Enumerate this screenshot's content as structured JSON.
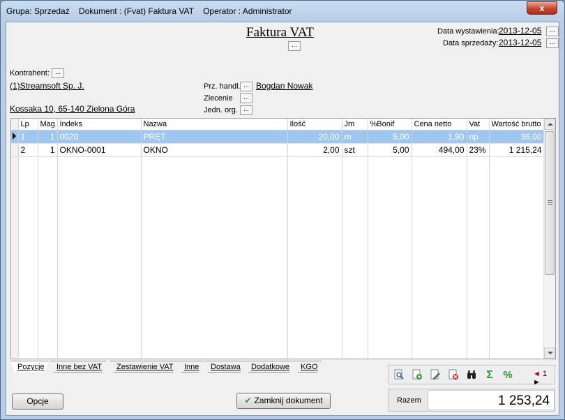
{
  "window": {
    "title": "Grupa: Sprzedaż    Dokument : (Fvat) Faktura VAT    Operator : Administrator",
    "close_glyph": "x"
  },
  "header": {
    "doc_title": "Faktura VAT",
    "dots": "...",
    "issue_date_label": "Data wystawienia:",
    "issue_date": "2013-12-05",
    "sale_date_label": "Data sprzedaży:",
    "sale_date": "2013-12-05"
  },
  "contractor": {
    "label": "Kontrahent:",
    "name": "(1)Streamsoft Sp. J.",
    "address": "Kossaka 10, 65-140 Zielona Góra"
  },
  "fields": {
    "sales_rep_label": "Prz. handl.",
    "sales_rep": "Bogdan Nowak",
    "order_label": "Zlecenie",
    "org_unit_label": "Jedn. org."
  },
  "grid": {
    "columns": [
      "Lp",
      "Mag",
      "Indeks",
      "Nazwa",
      "Ilość",
      "Jm",
      "%Bonif",
      "Cena netto",
      "Vat",
      "Wartość brutto"
    ],
    "rows": [
      {
        "lp": "1",
        "mag": "1",
        "indeks": "0020",
        "nazwa": "PRĘT",
        "ilosc": "20,00",
        "jm": "m",
        "bonif": "5,00",
        "cena": "1,90",
        "vat": "np",
        "brutto": "36,00"
      },
      {
        "lp": "2",
        "mag": "1",
        "indeks": "OKNO-0001",
        "nazwa": "OKNO",
        "ilosc": "2,00",
        "jm": "szt",
        "bonif": "5,00",
        "cena": "494,00",
        "vat": "23%",
        "brutto": "1 215,24"
      }
    ]
  },
  "tabs": [
    "Pozycje",
    "Inne bez VAT",
    "Zestawienie VAT",
    "Inne",
    "Dostawa",
    "Dodatkowe",
    "KGO"
  ],
  "toolbar": {
    "icons": [
      "preview-icon",
      "add-icon",
      "edit-icon",
      "delete-icon",
      "binoculars-icon",
      "sigma-icon",
      "percent-icon"
    ],
    "sigma": "Σ",
    "percent": "%",
    "page": "1"
  },
  "buttons": {
    "options": "Opcje",
    "close_document": "Zamknij dokument"
  },
  "total": {
    "label": "Razem",
    "value": "1 253,24"
  },
  "colors": {
    "selection": "#9ec7ef",
    "close_button": "#c9432b",
    "accent_green": "#2a9a2a"
  }
}
